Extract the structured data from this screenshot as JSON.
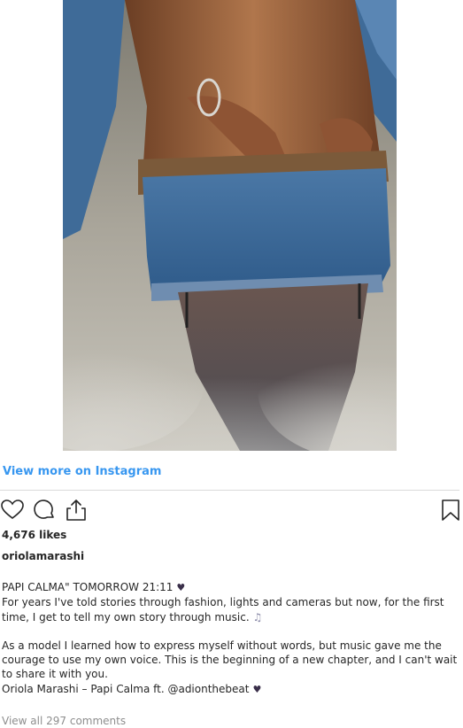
{
  "post": {
    "media": {
      "description_icon": "video-frame"
    },
    "view_more_link": "View more on Instagram",
    "actions": {
      "like_icon": "heart-outline-icon",
      "comment_icon": "comment-bubble-icon",
      "share_icon": "share-icon",
      "save_icon": "bookmark-icon"
    },
    "likes": "4,676 likes",
    "username": "oriolamarashi",
    "caption": {
      "line1": "PAPI CALMA\" TOMORROW 21:11",
      "line1_emoji": "♥",
      "paragraph1": "For years I've told stories through fashion, lights and cameras but now, for the first time, I get to tell my own story through music.",
      "paragraph1_emoji": "♫",
      "paragraph2": "As a model I learned how to express myself without words, but music gave me the courage to use my own voice. This is the beginning of a new chapter, and I can't wait to share it with you.",
      "credit": "Oriola Marashi – Papi Calma ft. @adionthebeat",
      "credit_emoji": "♥"
    },
    "comments_link": "View all 297 comments",
    "colors": {
      "link_blue": "#3897f0",
      "text": "#262626",
      "muted": "#8e8e8e",
      "divider": "#dbdbdb"
    }
  }
}
